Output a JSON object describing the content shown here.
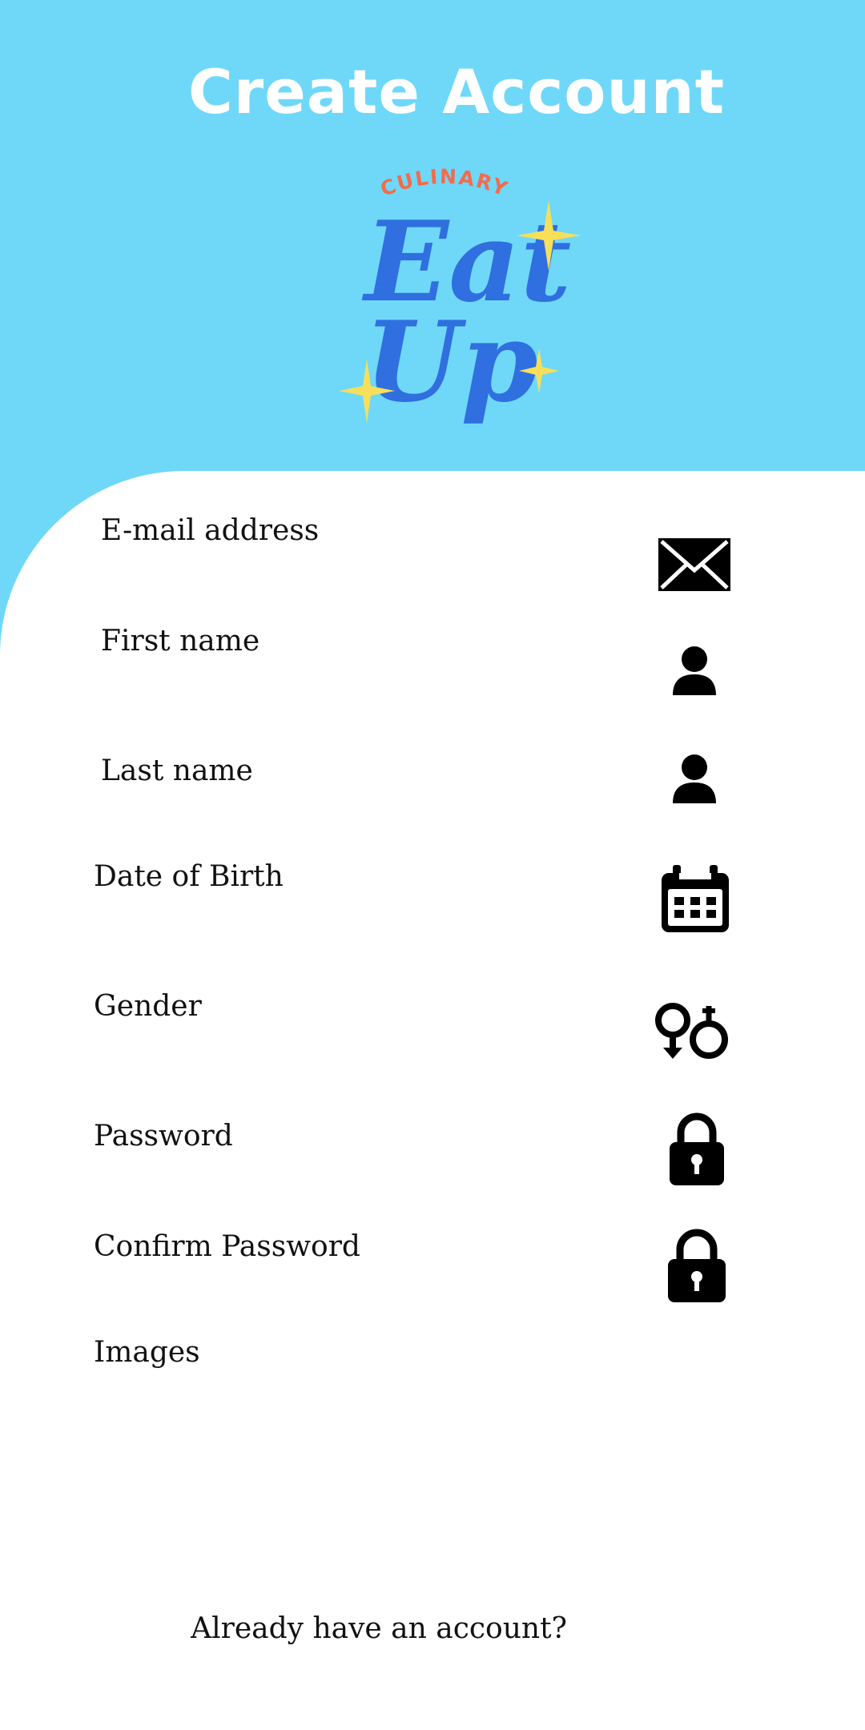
{
  "header": {
    "title": "Create Account",
    "background_color": "#6fd8f8"
  },
  "logo": {
    "subtitle": "CULINARY",
    "line1": "Eat",
    "line2": "Up",
    "colors": {
      "subtitle": "#f26b4f",
      "wordmark": "#2f6fe0",
      "stars": "#f7df5a"
    }
  },
  "form": {
    "fields": [
      {
        "label": "E-mail address",
        "icon": "envelope-icon"
      },
      {
        "label": "First name",
        "icon": "person-icon"
      },
      {
        "label": "Last name",
        "icon": "person-icon"
      },
      {
        "label": "Date of Birth",
        "icon": "calendar-icon"
      },
      {
        "label": "Gender",
        "icon": "gender-icon"
      },
      {
        "label": "Password",
        "icon": "lock-icon"
      },
      {
        "label": "Confirm Password",
        "icon": "lock-icon"
      },
      {
        "label": "Images",
        "icon": ""
      }
    ]
  },
  "footer": {
    "signin_link": "Already have an account?"
  }
}
